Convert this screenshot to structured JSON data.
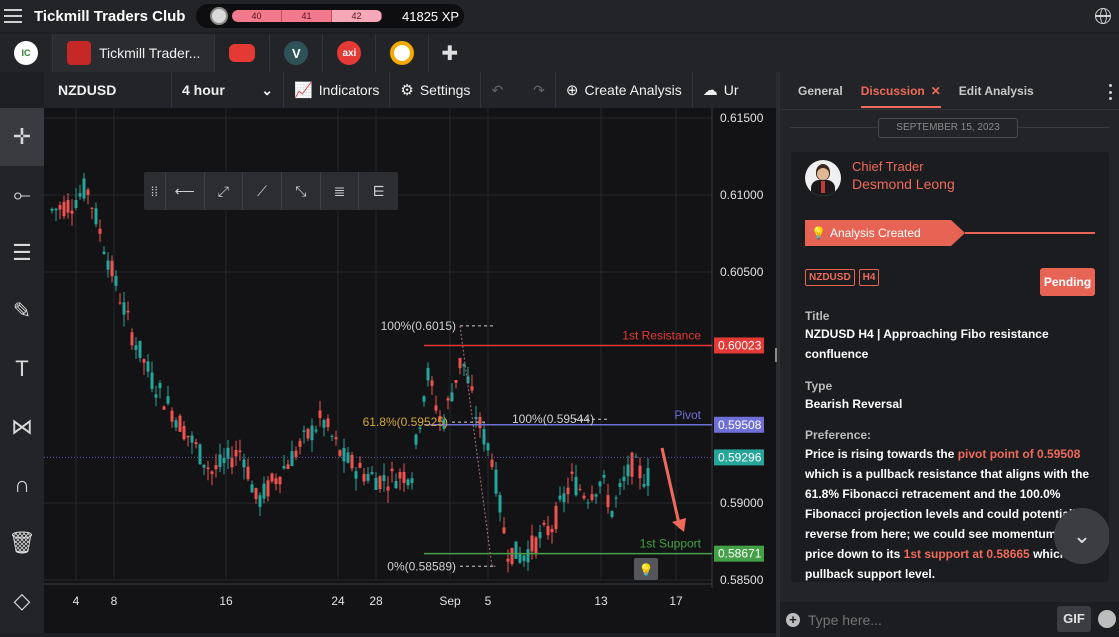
{
  "app": {
    "title": "Tickmill Traders Club",
    "xp": "41825 XP",
    "levels": [
      "40",
      "41",
      "42"
    ]
  },
  "tabs": [
    {
      "label": "Tickmill Trader...",
      "logo": "tickmill-logo"
    },
    {
      "label": "",
      "logo": "broker-logo-red"
    },
    {
      "label": "",
      "logo": "broker-logo-v"
    },
    {
      "label": "",
      "logo": "axi-logo",
      "text": "axi"
    },
    {
      "label": "",
      "logo": "broker-logo-c"
    }
  ],
  "toolbar": {
    "symbol": "NZDUSD",
    "timeframe": "4 hour",
    "indicators": "Indicators",
    "settings": "Settings",
    "create_analysis": "Create Analysis",
    "more": "Ur"
  },
  "chart_data": {
    "type": "candlestick",
    "symbol": "NZDUSD",
    "price_ticks": [
      "0.61500",
      "0.61000",
      "0.60500",
      "0.60023",
      "0.59508",
      "0.59296",
      "0.59000",
      "0.58671",
      "0.58500"
    ],
    "date_ticks": [
      "4",
      "8",
      "16",
      "24",
      "28",
      "Sep",
      "5",
      "13",
      "17"
    ],
    "lines": [
      {
        "name": "1st Resistance",
        "value": 0.60023,
        "color": "#e53935"
      },
      {
        "name": "Pivot",
        "value": 0.59508,
        "color": "#6f6fd8"
      },
      {
        "name": "1st Support",
        "value": 0.58671,
        "color": "#43a047"
      }
    ],
    "current_price": 0.59296,
    "fib_labels": [
      "100%(0.6015)",
      "61.8%(0.59525)",
      "100%(0.59544)",
      "0%(0.58589)"
    ],
    "fib_values": [
      0.6015,
      0.59525,
      0.59544,
      0.58589
    ],
    "ylim": [
      0.585,
      0.615
    ]
  },
  "panel": {
    "tabs": [
      "General",
      "Discussion",
      "Edit Analysis"
    ],
    "date": "SEPTEMBER 15, 2023",
    "author_role": "Chief Trader",
    "author_name": "Desmond Leong",
    "banner": "Analysis Created",
    "badges": [
      "NZDUSD",
      "H4"
    ],
    "status": "Pending",
    "title_label": "Title",
    "title": "NZDUSD H4 | Approaching Fibo resistance confluence",
    "type_label": "Type",
    "type": "Bearish Reversal",
    "pref_label": "Preference:",
    "pref_1": "Price is rising towards the ",
    "pref_hl1": "pivot point of 0.59508",
    "pref_2": " which is a pullback resistance that aligns with the 61.8% Fibonacci retracement and the 100.0% Fibonacci projection levels and could potentially reverse from here; we could see momentum push price down to its ",
    "pref_hl2": "1st support at 0.58665",
    "pref_3": " which is a pullback support level.",
    "composer_placeholder": "Type here...",
    "gif": "GIF"
  }
}
